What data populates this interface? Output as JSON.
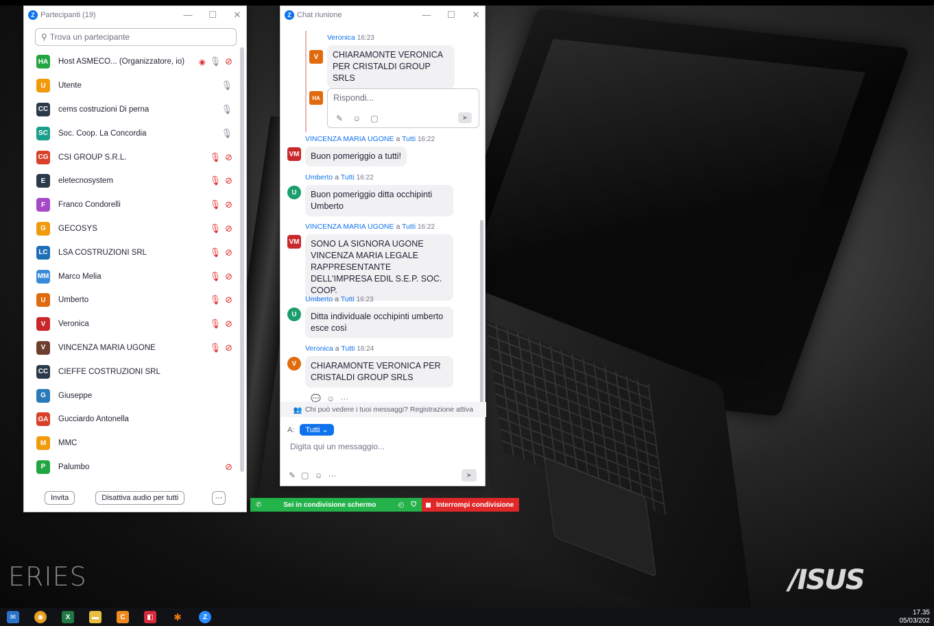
{
  "participants_window": {
    "title": "Partecipanti (19)",
    "search_placeholder": "Trova un partecipante",
    "participants": [
      {
        "initials": "HA",
        "name": "Host ASMECO... (Organizzatore, io)",
        "color": "#23a541",
        "icons": [
          "share",
          "rec",
          "mic",
          "video-off"
        ]
      },
      {
        "initials": "U",
        "name": "Utente",
        "color": "#f09a0c",
        "icons": [
          "mic"
        ]
      },
      {
        "initials": "CC",
        "name": "cems costruzioni Di perna",
        "color": "#2b3a4a",
        "icons": [
          "mic"
        ]
      },
      {
        "initials": "SC",
        "name": "Soc. Coop. La Concordia",
        "color": "#1a9e8c",
        "icons": [
          "mic"
        ]
      },
      {
        "initials": "CG",
        "name": "CSI GROUP S.R.L.",
        "color": "#d8402a",
        "icons": [
          "mic-off",
          "video-off"
        ]
      },
      {
        "initials": "E",
        "name": "eletecnosystem",
        "color": "#2b3a4a",
        "icons": [
          "mic-off",
          "video-off"
        ]
      },
      {
        "initials": "F",
        "name": "Franco Condorelli",
        "color": "#a547c8",
        "icons": [
          "mic-off",
          "video-off"
        ]
      },
      {
        "initials": "G",
        "name": "GECOSYS",
        "color": "#f09a0c",
        "icons": [
          "mic-off",
          "video-off"
        ]
      },
      {
        "initials": "LC",
        "name": "LSA COSTRUZIONI SRL",
        "color": "#1f6fb8",
        "icons": [
          "mic-off",
          "video-off"
        ]
      },
      {
        "initials": "MM",
        "name": "Marco Melia",
        "color": "#3a8ad8",
        "icons": [
          "mic-off",
          "video-off"
        ]
      },
      {
        "initials": "U",
        "name": "Umberto",
        "color": "#e06b0c",
        "icons": [
          "mic-off",
          "video-off"
        ]
      },
      {
        "initials": "V",
        "name": "Veronica",
        "color": "#c8282a",
        "icons": [
          "mic-off",
          "video-off"
        ]
      },
      {
        "initials": "V",
        "name": "VINCENZA MARIA UGONE",
        "color": "#6b3e2e",
        "icons": [
          "mic-off",
          "video-off"
        ]
      },
      {
        "initials": "CC",
        "name": "CIEFFE COSTRUZIONI SRL",
        "color": "#2b3a4a",
        "icons": []
      },
      {
        "initials": "G",
        "name": "Giuseppe",
        "color": "#2a7ab8",
        "icons": []
      },
      {
        "initials": "GA",
        "name": "Gucciardo Antonella",
        "color": "#d8402a",
        "icons": []
      },
      {
        "initials": "M",
        "name": "MMC",
        "color": "#f09a0c",
        "icons": []
      },
      {
        "initials": "P",
        "name": "Palumbo",
        "color": "#23a541",
        "icons": [
          "video-off"
        ]
      }
    ],
    "footer": {
      "invite": "Invita",
      "mute_all": "Disattiva audio per tutti",
      "more": "···"
    }
  },
  "chat_window": {
    "title": "Chat riunione",
    "thread": {
      "sender": "Veronica",
      "time": "16:23",
      "avatar": "V",
      "avatar_color": "#e06b0c",
      "text": "CHIARAMONTE VERONICA PER CRISTALDI GROUP SRLS",
      "reply_avatar": "HA",
      "reply_avatar_color": "#e06b0c",
      "reply_placeholder": "Rispondi..."
    },
    "messages": [
      {
        "sender": "VINCENZA MARIA UGONE",
        "to_word": "a",
        "to": "Tutti",
        "time": "16:22",
        "avatar": "VM",
        "avatar_color": "#c8282a",
        "text": "Buon pomeriggio a tutti!"
      },
      {
        "sender": "Umberto",
        "to_word": "a",
        "to": "Tutti",
        "time": "16:22",
        "avatar": "U",
        "avatar_color": "#1a9e6c",
        "text": "Buon pomeriggio ditta occhipinti Umberto"
      },
      {
        "sender": "VINCENZA MARIA UGONE",
        "to_word": "a",
        "to": "Tutti",
        "time": "16:22",
        "avatar": "VM",
        "avatar_color": "#c8282a",
        "text": "SONO LA SIGNORA UGONE VINCENZA MARIA LEGALE RAPPRESENTANTE DELL'IMPRESA EDIL S.E.P. SOC. COOP."
      },
      {
        "sender": "Umberto",
        "to_word": "a",
        "to": "Tutti",
        "time": "16:23",
        "avatar": "U",
        "avatar_color": "#1a9e6c",
        "text": "Ditta individuale occhipinti umberto esce così"
      },
      {
        "sender": "Veronica",
        "to_word": "a",
        "to": "Tutti",
        "time": "16:24",
        "avatar": "V",
        "avatar_color": "#e06b0c",
        "text": "CHIARAMONTE VERONICA PER CRISTALDI GROUP SRLS"
      }
    ],
    "privacy_note": "Chi può vedere i tuoi messaggi? Registrazione attiva",
    "to_label": "A:",
    "to_value": "Tutti",
    "input_placeholder": "Digita qui un messaggio...",
    "more": "···"
  },
  "share_bar": {
    "status": "Sei in condivisione schermo",
    "stop": "Interrompi condivisione"
  },
  "desktop": {
    "series_text": "ERIES",
    "brand": "/ISUS"
  },
  "taskbar": {
    "time": "17.35",
    "date": "05/03/202"
  }
}
